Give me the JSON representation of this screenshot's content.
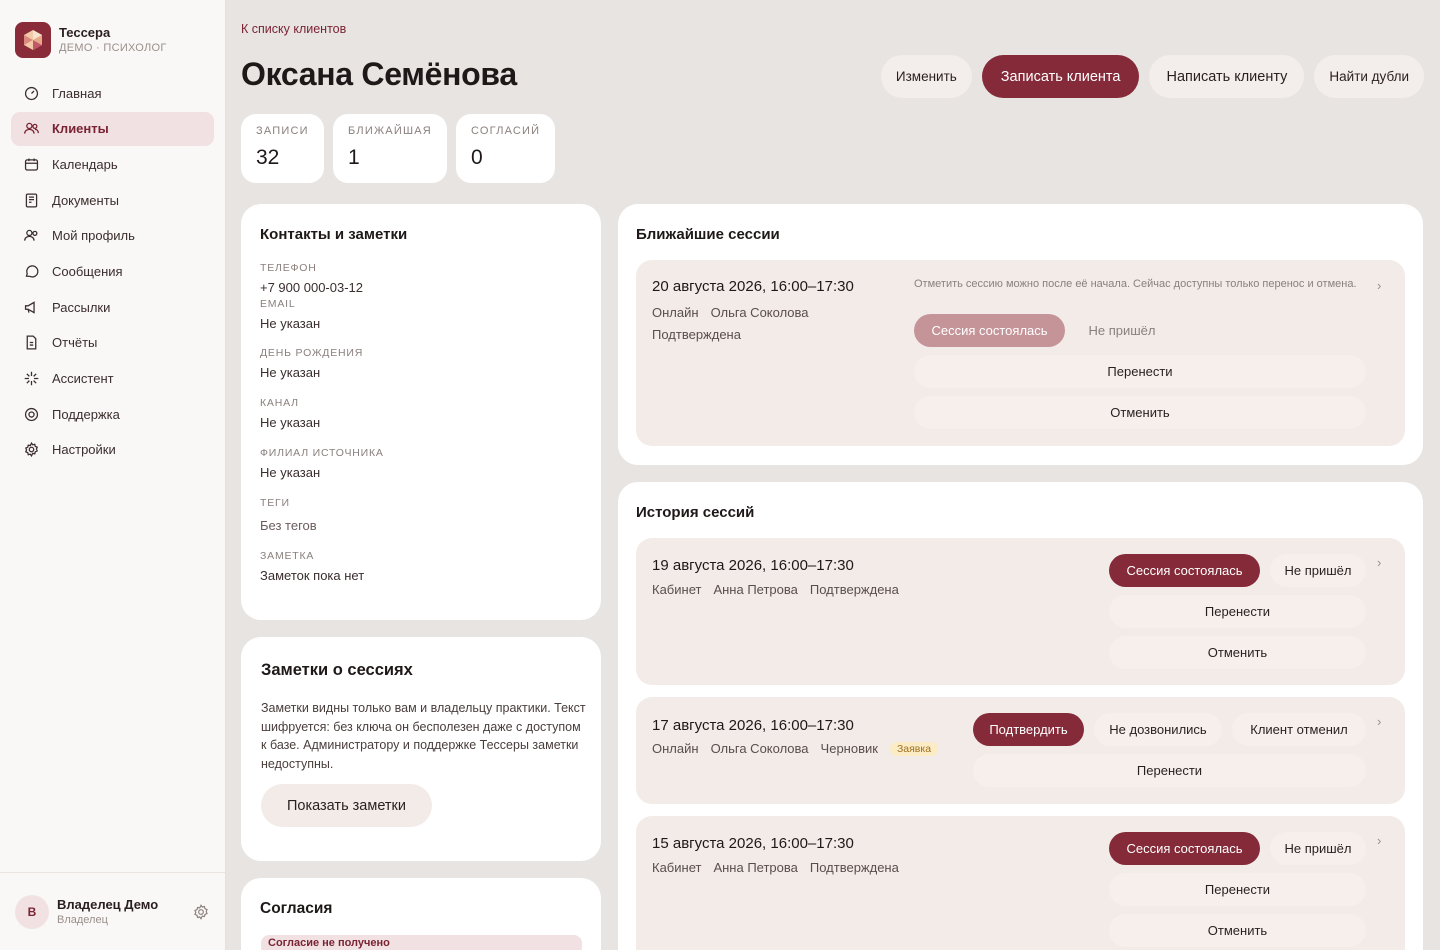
{
  "brand": {
    "title": "Тессера",
    "subtitle": "ДЕМО · ПСИХОЛОГ"
  },
  "nav": [
    {
      "label": "Главная",
      "icon": "dashboard-icon"
    },
    {
      "label": "Клиенты",
      "icon": "users-icon",
      "active": true
    },
    {
      "label": "Календарь",
      "icon": "calendar-icon"
    },
    {
      "label": "Документы",
      "icon": "document-icon"
    },
    {
      "label": "Мой профиль",
      "icon": "profile-icon"
    },
    {
      "label": "Сообщения",
      "icon": "message-icon"
    },
    {
      "label": "Рассылки",
      "icon": "megaphone-icon"
    },
    {
      "label": "Отчёты",
      "icon": "report-icon"
    },
    {
      "label": "Ассистент",
      "icon": "sparkle-icon"
    },
    {
      "label": "Поддержка",
      "icon": "lifebuoy-icon"
    },
    {
      "label": "Настройки",
      "icon": "gear-icon"
    }
  ],
  "user": {
    "initial": "В",
    "name": "Владелец Демо",
    "role": "Владелец"
  },
  "header": {
    "back": "К списку клиентов",
    "title": "Оксана Семёнова",
    "actions": {
      "edit": "Изменить",
      "book": "Записать клиента",
      "write": "Написать клиенту",
      "dupes": "Найти дубли"
    }
  },
  "stats": [
    {
      "label": "ЗАПИСИ",
      "value": "32"
    },
    {
      "label": "БЛИЖАЙШАЯ",
      "value": "1"
    },
    {
      "label": "СОГЛАСИЙ",
      "value": "0"
    }
  ],
  "contacts": {
    "title": "Контакты и заметки",
    "phone_label": "ТЕЛЕФОН",
    "phone": "+7 900 000-03-12",
    "email_label": "EMAIL",
    "email": "Не указан",
    "birthday_label": "ДЕНЬ РОЖДЕНИЯ",
    "birthday": "Не указан",
    "channel_label": "КАНАЛ",
    "channel": "Не указан",
    "branch_label": "ФИЛИАЛ ИСТОЧНИКА",
    "branch": "Не указан",
    "tags_label": "ТЕГИ",
    "tags": "Без тегов",
    "note_label": "ЗАМЕТКА",
    "note": "Заметок пока нет"
  },
  "session_notes": {
    "title": "Заметки о сессиях",
    "text": "Заметки видны только вам и владельцу практики. Текст шифруется: без ключа он бесполезен даже с доступом к базе. Администратору и поддержке Тессеры заметки недоступны.",
    "button": "Показать заметки"
  },
  "consents": {
    "title": "Согласия",
    "badge": "Согласие не получено"
  },
  "upcoming": {
    "title": "Ближайшие сессии",
    "date": "20 августа 2026, 16:00–17:30",
    "format": "Онлайн",
    "specialist": "Ольга Соколова",
    "status": "Подтверждена",
    "hint": "Отметить сессию можно после её начала. Сейчас доступны только перенос и отмена.",
    "done": "Сессия состоялась",
    "noshow": "Не пришёл",
    "reschedule": "Перенести",
    "cancel": "Отменить"
  },
  "history": {
    "title": "История сессий",
    "items": [
      {
        "date": "19 августа 2026, 16:00–17:30",
        "format": "Кабинет",
        "specialist": "Анна Петрова",
        "status": "Подтверждена",
        "done": "Сессия состоялась",
        "noshow": "Не пришёл",
        "reschedule": "Перенести",
        "cancel": "Отменить"
      },
      {
        "date": "17 августа 2026, 16:00–17:30",
        "format": "Онлайн",
        "specialist": "Ольга Соколова",
        "status": "Черновик",
        "badge": "Заявка",
        "confirm": "Подтвердить",
        "no_answer": "Не дозвонились",
        "client_cancel": "Клиент отменил",
        "reschedule": "Перенести"
      },
      {
        "date": "15 августа 2026, 16:00–17:30",
        "format": "Кабинет",
        "specialist": "Анна Петрова",
        "status": "Подтверждена",
        "done": "Сессия состоялась",
        "noshow": "Не пришёл",
        "reschedule": "Перенести",
        "cancel": "Отменить"
      }
    ]
  },
  "colors": {
    "accent": "#842a38",
    "active_bg": "#f1e1e3",
    "session_bg": "#f3ebe8"
  }
}
